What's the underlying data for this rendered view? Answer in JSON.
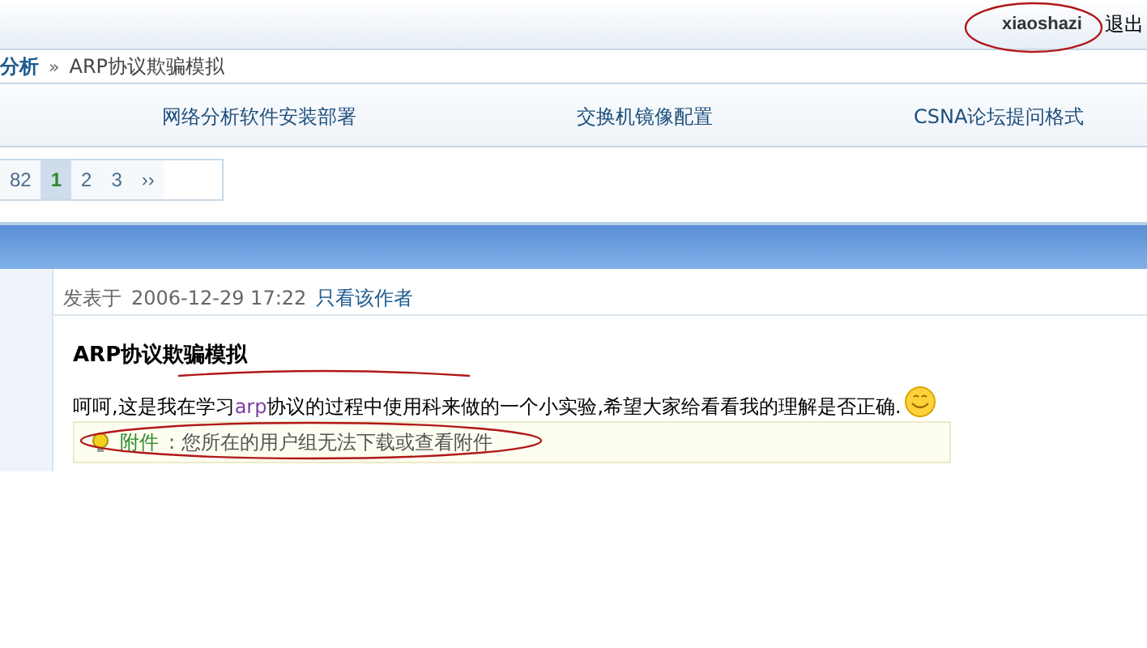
{
  "top_bar": {
    "username": "xiaoshazi",
    "logout": "退出"
  },
  "breadcrumb": {
    "forum": "分析",
    "separator": "»",
    "thread": "ARP协议欺骗模拟"
  },
  "nav_links": [
    "网络分析软件安装部署",
    "交换机镜像配置",
    "CSNA论坛提问格式"
  ],
  "pagination": [
    {
      "label": "82",
      "selected": false
    },
    {
      "label": "1",
      "selected": true
    },
    {
      "label": "2",
      "selected": false
    },
    {
      "label": "3",
      "selected": false
    },
    {
      "label": "››",
      "selected": false
    }
  ],
  "post": {
    "posted_label": "发表于",
    "posted_time": "2006-12-29 17:22",
    "author_only_link": "只看该作者",
    "title": "ARP协议欺骗模拟",
    "body": [
      {
        "kind": "text",
        "text": "呵呵,这是我在学习"
      },
      {
        "kind": "link",
        "text": "arp"
      },
      {
        "kind": "text",
        "text": "协议的过程中使用科来做的一个小实验,希望大家给看看我的理解是否正确."
      }
    ],
    "attachment": {
      "label": "附件",
      "message": ": 您所在的用户组无法下载或查看附件"
    }
  }
}
